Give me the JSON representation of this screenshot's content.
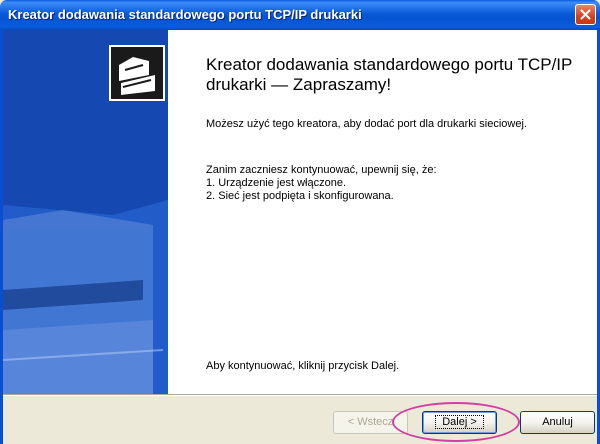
{
  "window": {
    "title": "Kreator dodawania standardowego portu TCP/IP drukarki"
  },
  "main": {
    "heading": "Kreator dodawania standardowego portu TCP/IP drukarki — Zapraszamy!",
    "intro": "Możesz użyć tego kreatora, aby dodać port dla drukarki sieciowej.",
    "checklist_intro": "Zanim zaczniesz kontynuować, upewnij się, że:",
    "checklist": [
      "1. Urządzenie jest włączone.",
      "2. Sieć jest podpięta i skonfigurowana."
    ],
    "continue_hint": "Aby kontynuować, kliknij przycisk Dalej."
  },
  "buttons": {
    "back": "< Wstecz",
    "next": "Dalej >",
    "cancel": "Anuluj"
  },
  "colors": {
    "titlebar": "#0a5bd9",
    "banner": "#1a55c2",
    "highlight_ellipse": "#d23fa0"
  }
}
